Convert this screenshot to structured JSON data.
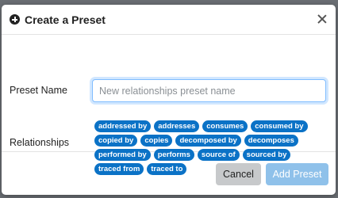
{
  "modal": {
    "title": "Create a Preset",
    "preset_name_label": "Preset Name",
    "preset_name_placeholder": "New relationships preset name",
    "preset_name_value": "",
    "relationships_label": "Relationships",
    "relationships": [
      "addressed by",
      "addresses",
      "consumes",
      "consumed by",
      "copied by",
      "copies",
      "decomposed by",
      "decomposes",
      "performed by",
      "performs",
      "source of",
      "sourced by",
      "traced from",
      "traced to"
    ],
    "cancel_label": "Cancel",
    "add_label": "Add Preset"
  },
  "icons": {
    "title_icon": "plus-circle-icon",
    "close_icon": "close-icon"
  },
  "colors": {
    "chip_bg": "#0b72c6",
    "add_button_bg": "#8fc1ea",
    "cancel_button_bg": "#c7c9cb",
    "input_focus_border": "#80bdff"
  }
}
